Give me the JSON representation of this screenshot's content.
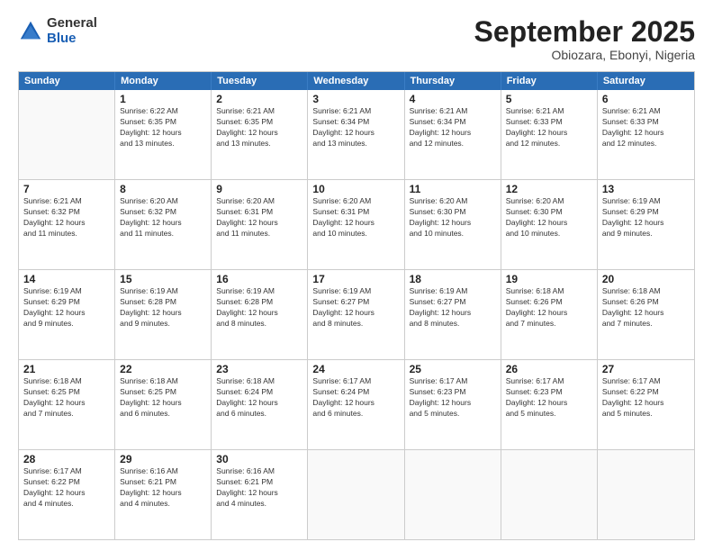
{
  "logo": {
    "general": "General",
    "blue": "Blue"
  },
  "title": "September 2025",
  "subtitle": "Obiozara, Ebonyi, Nigeria",
  "header_days": [
    "Sunday",
    "Monday",
    "Tuesday",
    "Wednesday",
    "Thursday",
    "Friday",
    "Saturday"
  ],
  "weeks": [
    [
      {
        "day": "",
        "info": "",
        "empty": true
      },
      {
        "day": "1",
        "info": "Sunrise: 6:22 AM\nSunset: 6:35 PM\nDaylight: 12 hours\nand 13 minutes.",
        "empty": false
      },
      {
        "day": "2",
        "info": "Sunrise: 6:21 AM\nSunset: 6:35 PM\nDaylight: 12 hours\nand 13 minutes.",
        "empty": false
      },
      {
        "day": "3",
        "info": "Sunrise: 6:21 AM\nSunset: 6:34 PM\nDaylight: 12 hours\nand 13 minutes.",
        "empty": false
      },
      {
        "day": "4",
        "info": "Sunrise: 6:21 AM\nSunset: 6:34 PM\nDaylight: 12 hours\nand 12 minutes.",
        "empty": false
      },
      {
        "day": "5",
        "info": "Sunrise: 6:21 AM\nSunset: 6:33 PM\nDaylight: 12 hours\nand 12 minutes.",
        "empty": false
      },
      {
        "day": "6",
        "info": "Sunrise: 6:21 AM\nSunset: 6:33 PM\nDaylight: 12 hours\nand 12 minutes.",
        "empty": false
      }
    ],
    [
      {
        "day": "7",
        "info": "Sunrise: 6:21 AM\nSunset: 6:32 PM\nDaylight: 12 hours\nand 11 minutes.",
        "empty": false
      },
      {
        "day": "8",
        "info": "Sunrise: 6:20 AM\nSunset: 6:32 PM\nDaylight: 12 hours\nand 11 minutes.",
        "empty": false
      },
      {
        "day": "9",
        "info": "Sunrise: 6:20 AM\nSunset: 6:31 PM\nDaylight: 12 hours\nand 11 minutes.",
        "empty": false
      },
      {
        "day": "10",
        "info": "Sunrise: 6:20 AM\nSunset: 6:31 PM\nDaylight: 12 hours\nand 10 minutes.",
        "empty": false
      },
      {
        "day": "11",
        "info": "Sunrise: 6:20 AM\nSunset: 6:30 PM\nDaylight: 12 hours\nand 10 minutes.",
        "empty": false
      },
      {
        "day": "12",
        "info": "Sunrise: 6:20 AM\nSunset: 6:30 PM\nDaylight: 12 hours\nand 10 minutes.",
        "empty": false
      },
      {
        "day": "13",
        "info": "Sunrise: 6:19 AM\nSunset: 6:29 PM\nDaylight: 12 hours\nand 9 minutes.",
        "empty": false
      }
    ],
    [
      {
        "day": "14",
        "info": "Sunrise: 6:19 AM\nSunset: 6:29 PM\nDaylight: 12 hours\nand 9 minutes.",
        "empty": false
      },
      {
        "day": "15",
        "info": "Sunrise: 6:19 AM\nSunset: 6:28 PM\nDaylight: 12 hours\nand 9 minutes.",
        "empty": false
      },
      {
        "day": "16",
        "info": "Sunrise: 6:19 AM\nSunset: 6:28 PM\nDaylight: 12 hours\nand 8 minutes.",
        "empty": false
      },
      {
        "day": "17",
        "info": "Sunrise: 6:19 AM\nSunset: 6:27 PM\nDaylight: 12 hours\nand 8 minutes.",
        "empty": false
      },
      {
        "day": "18",
        "info": "Sunrise: 6:19 AM\nSunset: 6:27 PM\nDaylight: 12 hours\nand 8 minutes.",
        "empty": false
      },
      {
        "day": "19",
        "info": "Sunrise: 6:18 AM\nSunset: 6:26 PM\nDaylight: 12 hours\nand 7 minutes.",
        "empty": false
      },
      {
        "day": "20",
        "info": "Sunrise: 6:18 AM\nSunset: 6:26 PM\nDaylight: 12 hours\nand 7 minutes.",
        "empty": false
      }
    ],
    [
      {
        "day": "21",
        "info": "Sunrise: 6:18 AM\nSunset: 6:25 PM\nDaylight: 12 hours\nand 7 minutes.",
        "empty": false
      },
      {
        "day": "22",
        "info": "Sunrise: 6:18 AM\nSunset: 6:25 PM\nDaylight: 12 hours\nand 6 minutes.",
        "empty": false
      },
      {
        "day": "23",
        "info": "Sunrise: 6:18 AM\nSunset: 6:24 PM\nDaylight: 12 hours\nand 6 minutes.",
        "empty": false
      },
      {
        "day": "24",
        "info": "Sunrise: 6:17 AM\nSunset: 6:24 PM\nDaylight: 12 hours\nand 6 minutes.",
        "empty": false
      },
      {
        "day": "25",
        "info": "Sunrise: 6:17 AM\nSunset: 6:23 PM\nDaylight: 12 hours\nand 5 minutes.",
        "empty": false
      },
      {
        "day": "26",
        "info": "Sunrise: 6:17 AM\nSunset: 6:23 PM\nDaylight: 12 hours\nand 5 minutes.",
        "empty": false
      },
      {
        "day": "27",
        "info": "Sunrise: 6:17 AM\nSunset: 6:22 PM\nDaylight: 12 hours\nand 5 minutes.",
        "empty": false
      }
    ],
    [
      {
        "day": "28",
        "info": "Sunrise: 6:17 AM\nSunset: 6:22 PM\nDaylight: 12 hours\nand 4 minutes.",
        "empty": false
      },
      {
        "day": "29",
        "info": "Sunrise: 6:16 AM\nSunset: 6:21 PM\nDaylight: 12 hours\nand 4 minutes.",
        "empty": false
      },
      {
        "day": "30",
        "info": "Sunrise: 6:16 AM\nSunset: 6:21 PM\nDaylight: 12 hours\nand 4 minutes.",
        "empty": false
      },
      {
        "day": "",
        "info": "",
        "empty": true
      },
      {
        "day": "",
        "info": "",
        "empty": true
      },
      {
        "day": "",
        "info": "",
        "empty": true
      },
      {
        "day": "",
        "info": "",
        "empty": true
      }
    ]
  ]
}
